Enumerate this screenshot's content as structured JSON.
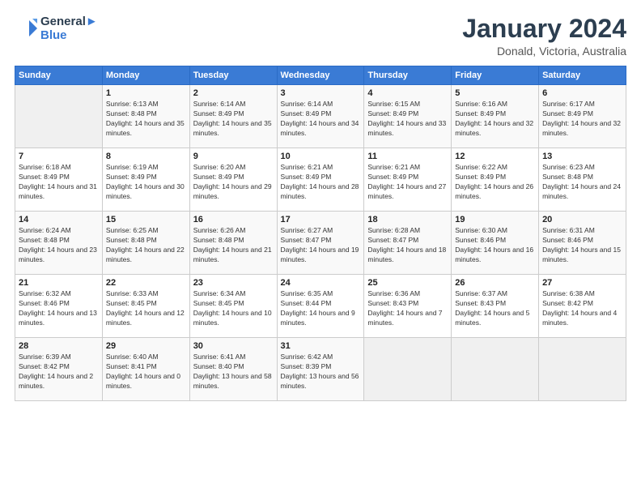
{
  "app": {
    "logo_line1": "General",
    "logo_line2": "Blue"
  },
  "header": {
    "month_year": "January 2024",
    "location": "Donald, Victoria, Australia"
  },
  "days_of_week": [
    "Sunday",
    "Monday",
    "Tuesday",
    "Wednesday",
    "Thursday",
    "Friday",
    "Saturday"
  ],
  "weeks": [
    [
      {
        "day": "",
        "sunrise": "",
        "sunset": "",
        "daylight": ""
      },
      {
        "day": "1",
        "sunrise": "6:13 AM",
        "sunset": "8:48 PM",
        "daylight": "14 hours and 35 minutes."
      },
      {
        "day": "2",
        "sunrise": "6:14 AM",
        "sunset": "8:49 PM",
        "daylight": "14 hours and 35 minutes."
      },
      {
        "day": "3",
        "sunrise": "6:14 AM",
        "sunset": "8:49 PM",
        "daylight": "14 hours and 34 minutes."
      },
      {
        "day": "4",
        "sunrise": "6:15 AM",
        "sunset": "8:49 PM",
        "daylight": "14 hours and 33 minutes."
      },
      {
        "day": "5",
        "sunrise": "6:16 AM",
        "sunset": "8:49 PM",
        "daylight": "14 hours and 32 minutes."
      },
      {
        "day": "6",
        "sunrise": "6:17 AM",
        "sunset": "8:49 PM",
        "daylight": "14 hours and 32 minutes."
      }
    ],
    [
      {
        "day": "7",
        "sunrise": "6:18 AM",
        "sunset": "8:49 PM",
        "daylight": "14 hours and 31 minutes."
      },
      {
        "day": "8",
        "sunrise": "6:19 AM",
        "sunset": "8:49 PM",
        "daylight": "14 hours and 30 minutes."
      },
      {
        "day": "9",
        "sunrise": "6:20 AM",
        "sunset": "8:49 PM",
        "daylight": "14 hours and 29 minutes."
      },
      {
        "day": "10",
        "sunrise": "6:21 AM",
        "sunset": "8:49 PM",
        "daylight": "14 hours and 28 minutes."
      },
      {
        "day": "11",
        "sunrise": "6:21 AM",
        "sunset": "8:49 PM",
        "daylight": "14 hours and 27 minutes."
      },
      {
        "day": "12",
        "sunrise": "6:22 AM",
        "sunset": "8:49 PM",
        "daylight": "14 hours and 26 minutes."
      },
      {
        "day": "13",
        "sunrise": "6:23 AM",
        "sunset": "8:48 PM",
        "daylight": "14 hours and 24 minutes."
      }
    ],
    [
      {
        "day": "14",
        "sunrise": "6:24 AM",
        "sunset": "8:48 PM",
        "daylight": "14 hours and 23 minutes."
      },
      {
        "day": "15",
        "sunrise": "6:25 AM",
        "sunset": "8:48 PM",
        "daylight": "14 hours and 22 minutes."
      },
      {
        "day": "16",
        "sunrise": "6:26 AM",
        "sunset": "8:48 PM",
        "daylight": "14 hours and 21 minutes."
      },
      {
        "day": "17",
        "sunrise": "6:27 AM",
        "sunset": "8:47 PM",
        "daylight": "14 hours and 19 minutes."
      },
      {
        "day": "18",
        "sunrise": "6:28 AM",
        "sunset": "8:47 PM",
        "daylight": "14 hours and 18 minutes."
      },
      {
        "day": "19",
        "sunrise": "6:30 AM",
        "sunset": "8:46 PM",
        "daylight": "14 hours and 16 minutes."
      },
      {
        "day": "20",
        "sunrise": "6:31 AM",
        "sunset": "8:46 PM",
        "daylight": "14 hours and 15 minutes."
      }
    ],
    [
      {
        "day": "21",
        "sunrise": "6:32 AM",
        "sunset": "8:46 PM",
        "daylight": "14 hours and 13 minutes."
      },
      {
        "day": "22",
        "sunrise": "6:33 AM",
        "sunset": "8:45 PM",
        "daylight": "14 hours and 12 minutes."
      },
      {
        "day": "23",
        "sunrise": "6:34 AM",
        "sunset": "8:45 PM",
        "daylight": "14 hours and 10 minutes."
      },
      {
        "day": "24",
        "sunrise": "6:35 AM",
        "sunset": "8:44 PM",
        "daylight": "14 hours and 9 minutes."
      },
      {
        "day": "25",
        "sunrise": "6:36 AM",
        "sunset": "8:43 PM",
        "daylight": "14 hours and 7 minutes."
      },
      {
        "day": "26",
        "sunrise": "6:37 AM",
        "sunset": "8:43 PM",
        "daylight": "14 hours and 5 minutes."
      },
      {
        "day": "27",
        "sunrise": "6:38 AM",
        "sunset": "8:42 PM",
        "daylight": "14 hours and 4 minutes."
      }
    ],
    [
      {
        "day": "28",
        "sunrise": "6:39 AM",
        "sunset": "8:42 PM",
        "daylight": "14 hours and 2 minutes."
      },
      {
        "day": "29",
        "sunrise": "6:40 AM",
        "sunset": "8:41 PM",
        "daylight": "14 hours and 0 minutes."
      },
      {
        "day": "30",
        "sunrise": "6:41 AM",
        "sunset": "8:40 PM",
        "daylight": "13 hours and 58 minutes."
      },
      {
        "day": "31",
        "sunrise": "6:42 AM",
        "sunset": "8:39 PM",
        "daylight": "13 hours and 56 minutes."
      },
      {
        "day": "",
        "sunrise": "",
        "sunset": "",
        "daylight": ""
      },
      {
        "day": "",
        "sunrise": "",
        "sunset": "",
        "daylight": ""
      },
      {
        "day": "",
        "sunrise": "",
        "sunset": "",
        "daylight": ""
      }
    ]
  ]
}
